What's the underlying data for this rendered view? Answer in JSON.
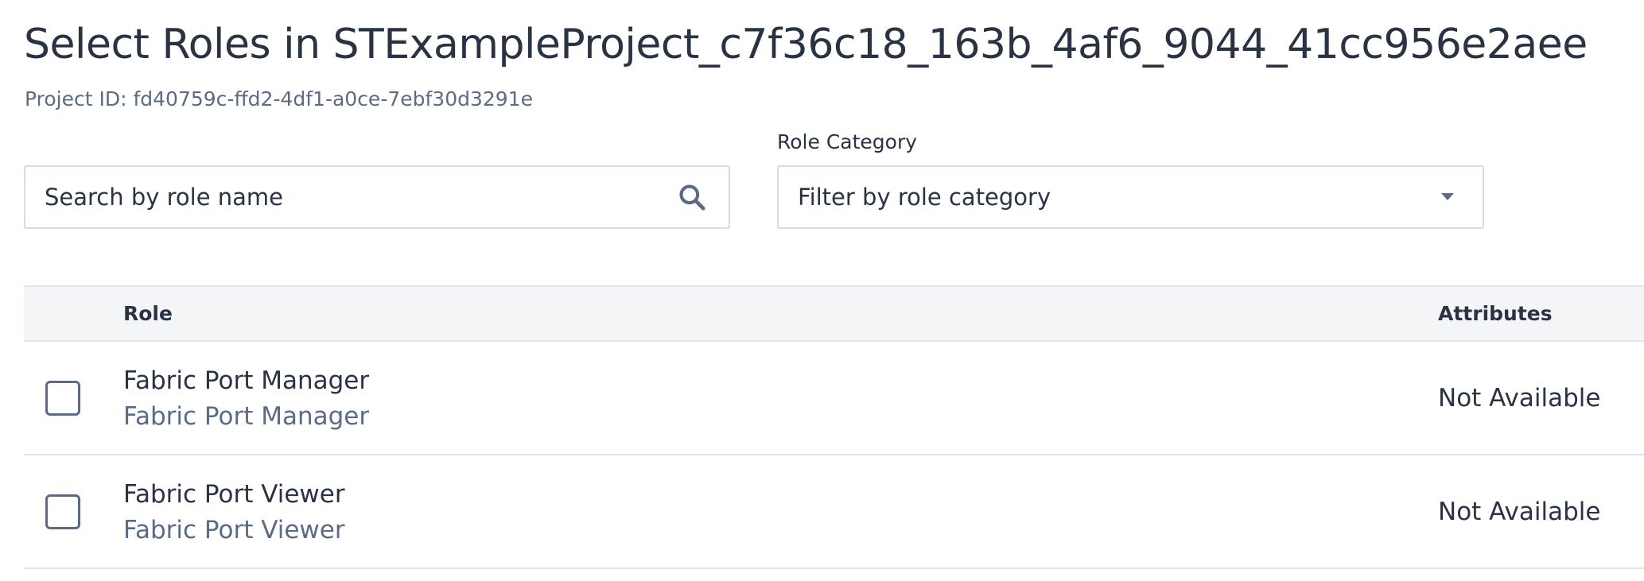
{
  "header": {
    "title": "Select Roles in STExampleProject_c7f36c18_163b_4af6_9044_41cc956e2aee",
    "project_id": "Project ID: fd40759c-ffd2-4df1-a0ce-7ebf30d3291e"
  },
  "search": {
    "placeholder": "Search by role name",
    "value": "",
    "icon": "search-icon"
  },
  "filter": {
    "label": "Role Category",
    "placeholder": "Filter by role category",
    "icon": "chevron-down-icon"
  },
  "table": {
    "columns": {
      "role": "Role",
      "attributes": "Attributes"
    },
    "rows": [
      {
        "name": "Fabric Port Manager",
        "description": "Fabric Port Manager",
        "attributes": "Not Available",
        "checked": false
      },
      {
        "name": "Fabric Port Viewer",
        "description": "Fabric Port Viewer",
        "attributes": "Not Available",
        "checked": false
      }
    ]
  },
  "colors": {
    "text": "#2a3343",
    "muted": "#5b6b85",
    "border": "#d6dbe3",
    "header_bg": "#f4f5f7"
  }
}
